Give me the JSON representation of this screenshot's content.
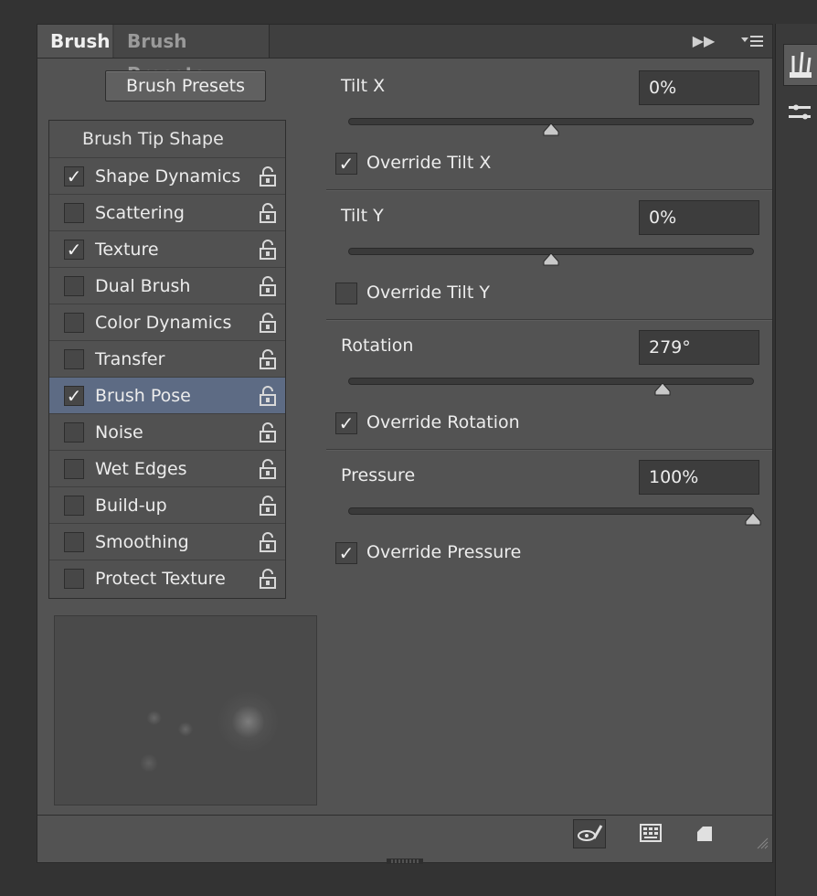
{
  "tabs": [
    {
      "label": "Brush",
      "active": true
    },
    {
      "label": "Brush Presets",
      "active": false
    }
  ],
  "presets_button": "Brush Presets",
  "options_header": "Brush Tip Shape",
  "options": [
    {
      "label": "Shape Dynamics",
      "checked": true
    },
    {
      "label": "Scattering",
      "checked": false
    },
    {
      "label": "Texture",
      "checked": true
    },
    {
      "label": "Dual Brush",
      "checked": false
    },
    {
      "label": "Color Dynamics",
      "checked": false
    },
    {
      "label": "Transfer",
      "checked": false
    },
    {
      "label": "Brush Pose",
      "checked": true,
      "selected": true
    },
    {
      "label": "Noise",
      "checked": false
    },
    {
      "label": "Wet Edges",
      "checked": false
    },
    {
      "label": "Build-up",
      "checked": false
    },
    {
      "label": "Smoothing",
      "checked": false
    },
    {
      "label": "Protect Texture",
      "checked": false
    }
  ],
  "controls": {
    "tilt_x": {
      "label": "Tilt X",
      "value": "0%",
      "slider_fraction": 0.5,
      "override_label": "Override Tilt X",
      "override_checked": true
    },
    "tilt_y": {
      "label": "Tilt Y",
      "value": "0%",
      "slider_fraction": 0.5,
      "override_label": "Override Tilt Y",
      "override_checked": false
    },
    "rotation": {
      "label": "Rotation",
      "value": "279°",
      "slider_fraction": 0.775,
      "override_label": "Override Rotation",
      "override_checked": true
    },
    "pressure": {
      "label": "Pressure",
      "value": "100%",
      "slider_fraction": 1.0,
      "override_label": "Override Pressure",
      "override_checked": true
    }
  },
  "glyphs": {
    "check": "✓",
    "collapse": "▶▶"
  },
  "icons": {
    "lock": "lock-icon",
    "menu": "panel-menu-icon",
    "toggle_brush_panel": "brush-toggle-icon",
    "open_preset_manager": "preset-manager-icon",
    "new_brush": "new-brush-icon"
  },
  "colors": {
    "panel_bg": "#535353",
    "selection": "#5d6b84",
    "field_bg": "#3d3d3d"
  }
}
